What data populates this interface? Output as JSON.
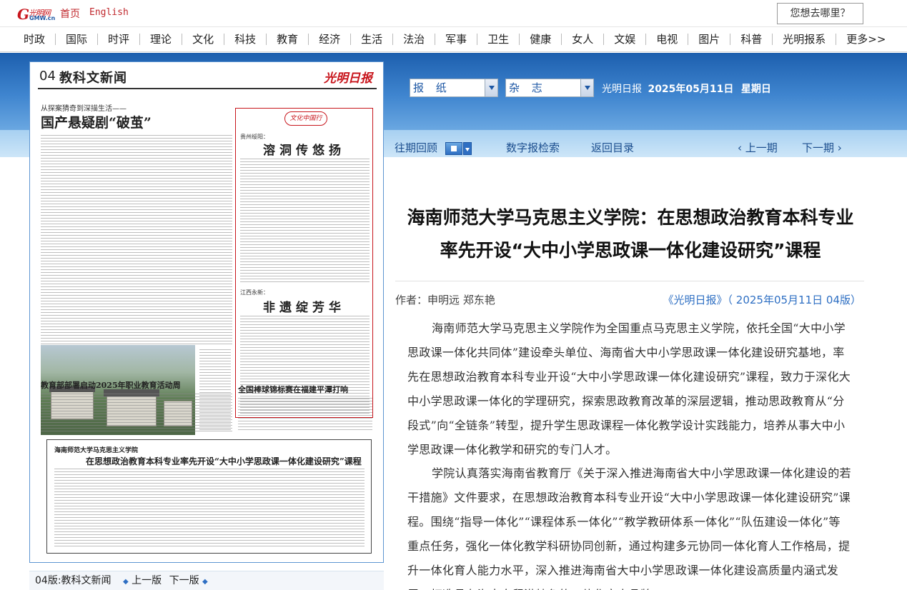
{
  "topbar": {
    "logo": {
      "mark": "G",
      "cn": "光明网",
      "en": "GMW.cn"
    },
    "home": "首页",
    "english": "English",
    "search_button": "您想去哪里？"
  },
  "nav": {
    "items": [
      "时政",
      "国际",
      "时评",
      "理论",
      "文化",
      "科技",
      "教育",
      "经济",
      "生活",
      "法治",
      "军事",
      "卫生",
      "健康",
      "女人",
      "文娱",
      "电视",
      "图片",
      "科普",
      "光明报系",
      "更多>>"
    ]
  },
  "selectors": {
    "paper": "报 纸",
    "magazine": "杂 志"
  },
  "publication": {
    "name": "光明日报",
    "date": "2025年05月11日",
    "weekday": "星期日"
  },
  "toolbar": {
    "archive": "往期回顾",
    "search": "数字报检索",
    "back": "返回目录",
    "prev": "‹  上一期",
    "next": "下一期  ›"
  },
  "paper_page": {
    "number": "04",
    "section": "教科文新闻",
    "masthead": "光明日报",
    "kicker": "从探案猜奇到深描生活——",
    "title": "国产悬疑剧“破茧”",
    "seal": "文化中国行",
    "box_loc_1": "贵州绥阳：",
    "box_head_1": "溶洞传悠扬",
    "box_loc_2": "江西永新：",
    "box_head_2": "非遗绽芳华",
    "headline_2": "教育部部署启动2025年职业教育活动周",
    "headline_3": "全国棒球锦标赛在福建平潭打响",
    "inset_kicker": "海南师范大学马克思主义学院",
    "inset_title": "在思想政治教育本科专业率先开设“大中小学思政课一体化建设研究”课程"
  },
  "paper_caption": {
    "label": "04版:教科文新闻",
    "prev": "上一版",
    "next": "下一版"
  },
  "article": {
    "headline_line1": "海南师范大学马克思主义学院：在思想政治教育本科专业",
    "headline_line2": "率先开设“大中小学思政课一体化建设研究”课程",
    "byline": "作者：申明远  郑东艳",
    "source": "《光明日报》（ 2025年05月11日   04版）",
    "paragraph1": "海南师范大学马克思主义学院作为全国重点马克思主义学院，依托全国“大中小学思政课一体化共同体”建设牵头单位、海南省大中小学思政课一体化建设研究基地，率先在思想政治教育本科专业开设“大中小学思政课一体化建设研究”课程，致力于深化大中小学思政课一体化的学理研究，探索思政教育改革的深层逻辑，推动思政教育从“分段式”向“全链条”转型，提升学生思政课程一体化教学设计实践能力，培养从事大中小学思政课一体化教学和研究的专门人才。",
    "paragraph2": "学院认真落实海南省教育厅《关于深入推进海南省大中小学思政课一体化建设的若干措施》文件要求，在思想政治教育本科专业开设“大中小学思政课一体化建设研究”课程。围绕“指导一体化”“课程体系一体化”“教学教研体系一体化”“队伍建设一体化”等重点任务，强化一体化教学科研协同创新，通过构建多元协同一体化育人工作格局，提升一体化育人能力水平，深入推进海南省大中小学思政课一体化建设高质量内涵式发展，打造具有海南自贸港特色的一体化育人品牌。"
  },
  "colors": {
    "brand_red": "#c8161d",
    "link_blue": "#2e6fc3",
    "banner_blue": "#1d5fae"
  }
}
